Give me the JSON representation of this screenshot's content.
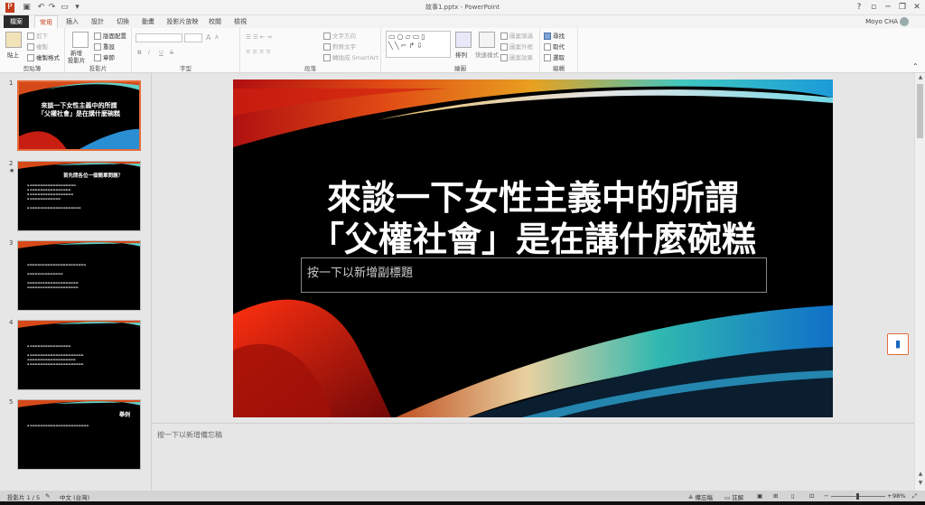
{
  "window": {
    "title": "故事1.pptx - PowerPoint",
    "controls": [
      "?",
      "▫",
      "─",
      "❐",
      "✕"
    ]
  },
  "qat": [
    "save-icon",
    "undo-icon",
    "redo-icon",
    "start-from-beginning-icon",
    "customize-icon"
  ],
  "tabs": [
    {
      "label": "檔案"
    },
    {
      "label": "常用"
    },
    {
      "label": "插入"
    },
    {
      "label": "設計"
    },
    {
      "label": "切換"
    },
    {
      "label": "動畫"
    },
    {
      "label": "投影片放映"
    },
    {
      "label": "校閱"
    },
    {
      "label": "檢視"
    }
  ],
  "user": {
    "name": "Moyo CHA"
  },
  "ribbon": {
    "clipboard": {
      "paste": "貼上",
      "cut": "剪下",
      "copy": "複製",
      "format_painter": "複製格式",
      "label": "剪貼簿"
    },
    "slides": {
      "new_slide": "新增",
      "new_slide_2": "投影片",
      "layout": "版面配置",
      "reset": "重設",
      "section": "章節",
      "label": "投影片"
    },
    "font": {
      "label": "字型",
      "bold": "B",
      "italic": "I",
      "underline": "U",
      "strike": "S",
      "grow": "A",
      "shrink": "A"
    },
    "paragraph": {
      "text_direction": "文字方向",
      "align_text": "對齊文字",
      "smartart": "轉換成 SmartArt",
      "label": "段落"
    },
    "drawing": {
      "arrange": "排列",
      "quick_styles": "快速樣式",
      "shape_fill": "圖案填滿",
      "shape_outline": "圖案外框",
      "shape_effects": "圖案效果",
      "label": "繪圖"
    },
    "editing": {
      "find": "尋找",
      "replace": "取代",
      "select": "選取",
      "label": "編輯"
    }
  },
  "slides": [
    {
      "number": "1",
      "title": "來談一下女性主義中的所謂\n「父權社會」是在講什麼碗糕"
    },
    {
      "number": "2",
      "title": "首先問各位一個簡單問題？"
    },
    {
      "number": "3",
      "title": ""
    },
    {
      "number": "4",
      "title": ""
    },
    {
      "number": "5",
      "title": "舉例"
    }
  ],
  "current_slide": {
    "title_line1": "來談一下女性主義中的所謂",
    "title_line2": "「父權社會」是在講什麼碗糕",
    "subtitle_placeholder": "按一下以新增副標題"
  },
  "notes_placeholder": "按一下以新增備忘稿",
  "status": {
    "slide_counter": "投影片 1 / 5",
    "language": "中文 (台灣)",
    "notes": "備忘稿",
    "comments": "註解",
    "zoom_percent": 98,
    "zoom": "98%"
  },
  "colors": {
    "accent": "#c43e1c",
    "selection": "#e46c3a"
  }
}
